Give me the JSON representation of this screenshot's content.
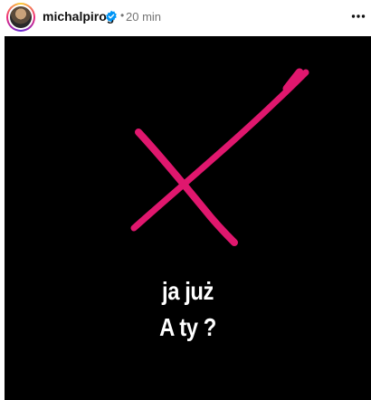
{
  "post_header": {
    "username": "michalpirog",
    "separator": "•",
    "time": "20 min"
  },
  "post_image": {
    "line1": "ja już",
    "line2": "A ty ?",
    "mark_color": "#e0176e",
    "background_color": "#000000"
  },
  "icons": {
    "verified": "verified-badge-icon",
    "more": "more-options-icon"
  }
}
